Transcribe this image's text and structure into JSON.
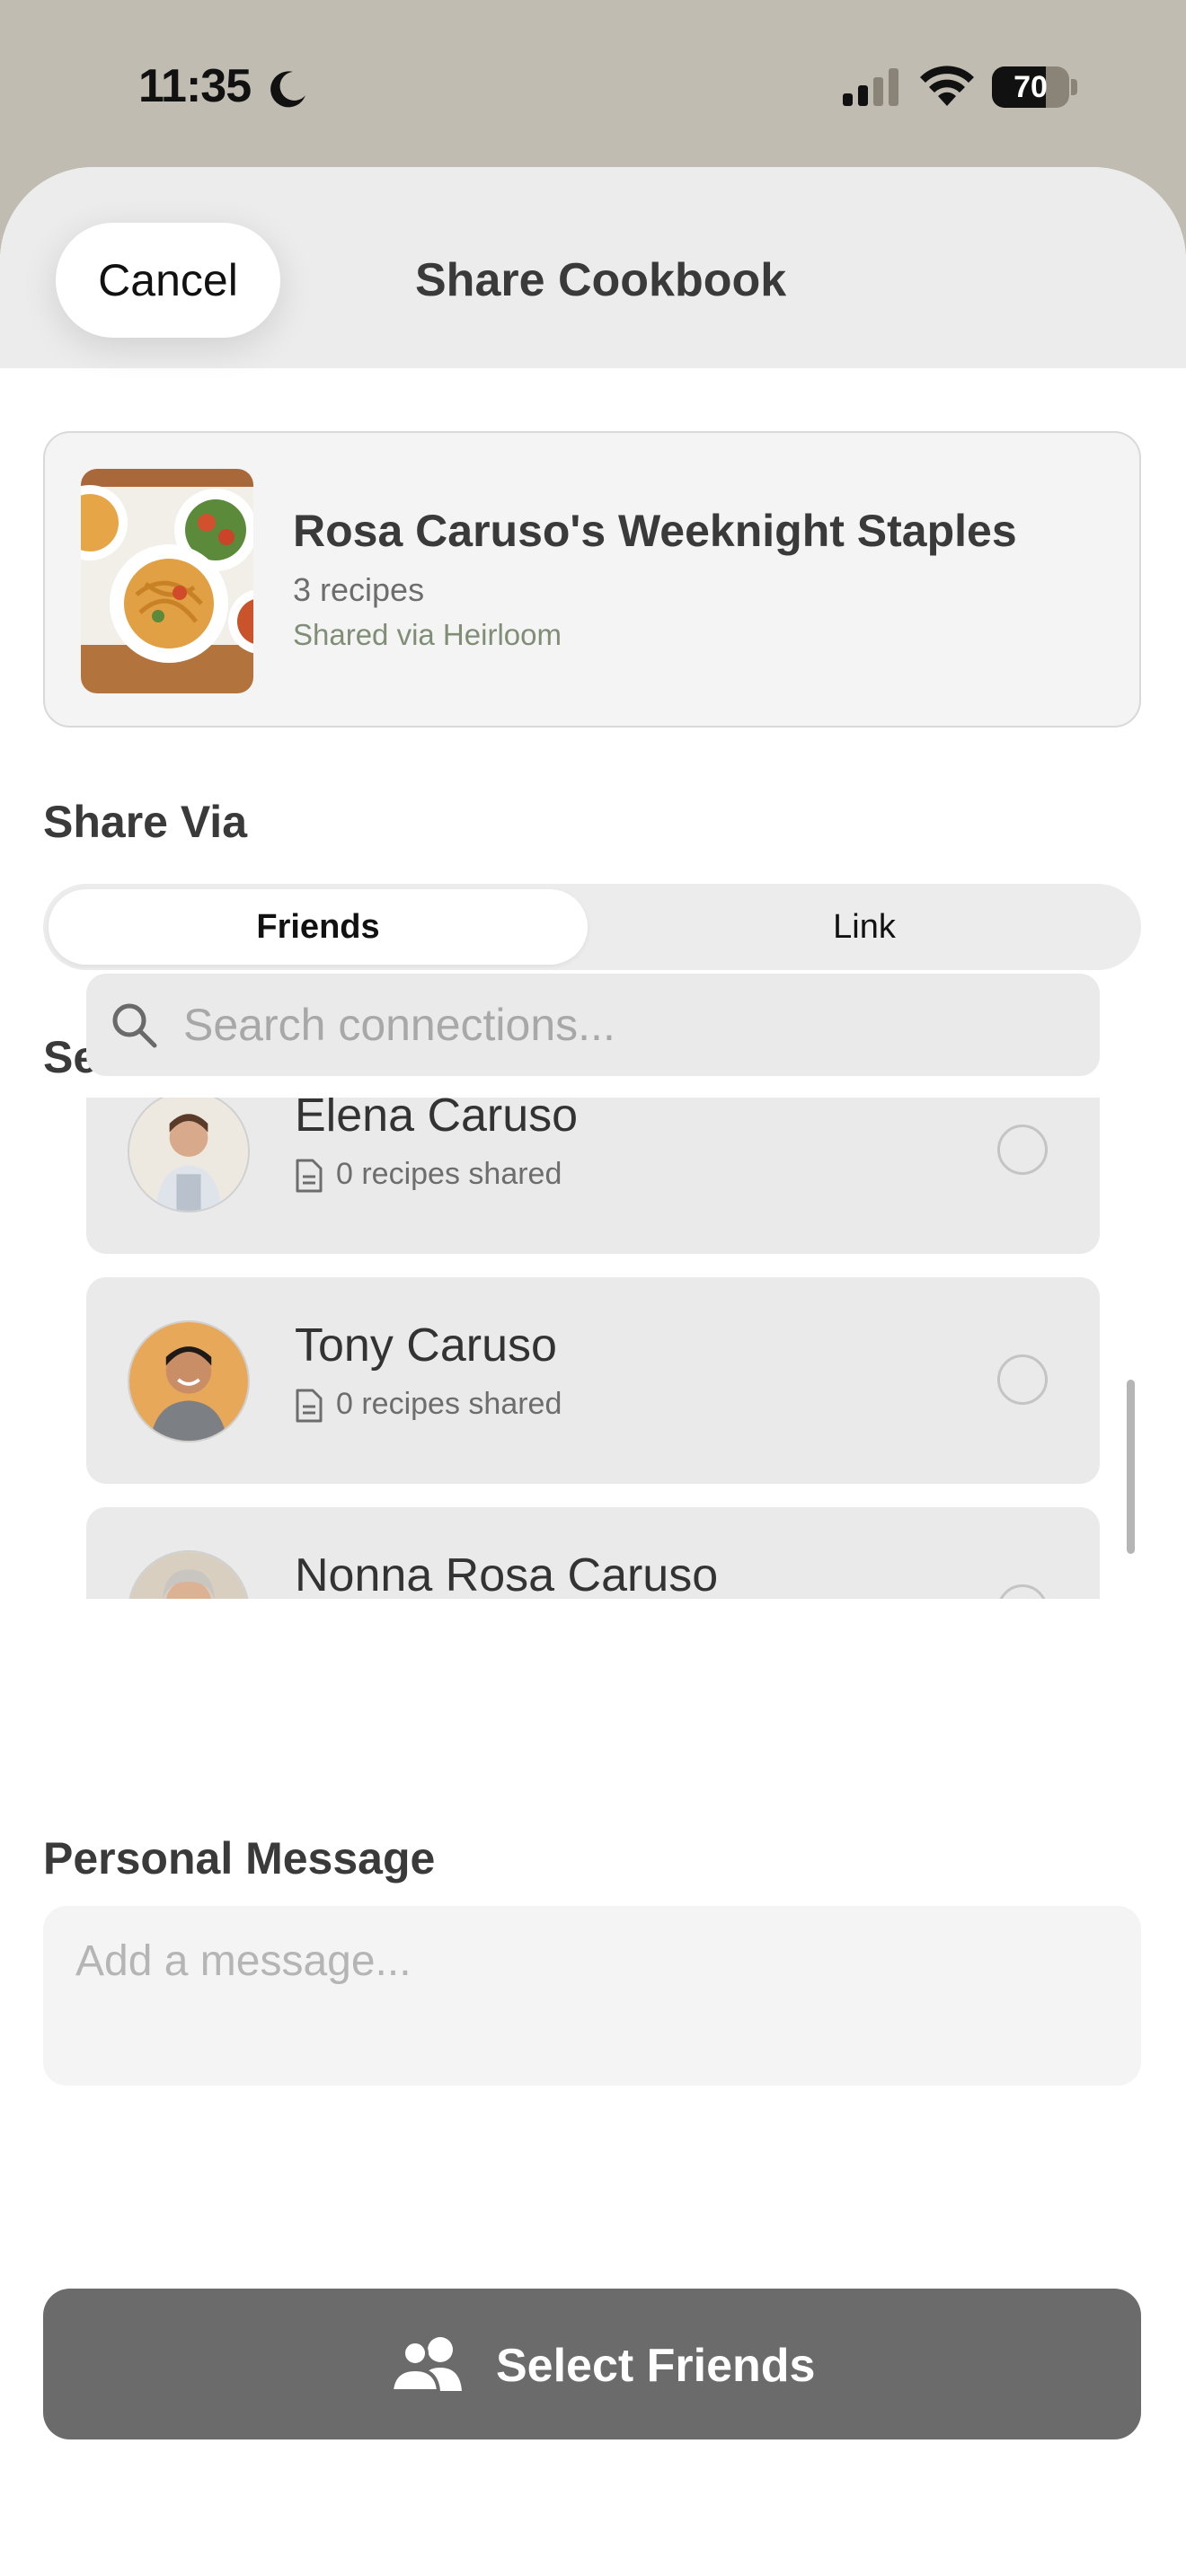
{
  "status_bar": {
    "time": "11:35",
    "battery": "70",
    "battery_level": 0.7
  },
  "header": {
    "cancel_label": "Cancel",
    "title": "Share Cookbook"
  },
  "cookbook": {
    "name": "Rosa Caruso's Weeknight Staples",
    "recipe_count": "3 recipes",
    "source": "Shared via Heirloom"
  },
  "share_via": {
    "label": "Share Via",
    "options": [
      "Friends",
      "Link"
    ],
    "selected": "Friends"
  },
  "friends": {
    "label": "Select Friends",
    "search_placeholder": "Search connections...",
    "list": [
      {
        "name": "Elena Caruso",
        "shared": "0 recipes shared",
        "selected": false
      },
      {
        "name": "Tony Caruso",
        "shared": "0 recipes shared",
        "selected": false
      },
      {
        "name": "Nonna Rosa Caruso",
        "selected": false
      }
    ]
  },
  "message": {
    "label": "Personal Message",
    "placeholder": "Add a message..."
  },
  "cta": {
    "label": "Select Friends",
    "icon": "people-icon"
  }
}
